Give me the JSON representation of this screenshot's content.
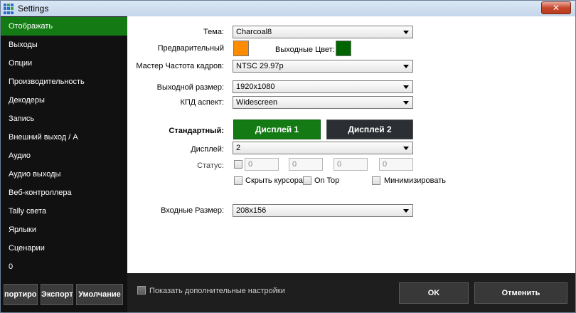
{
  "window": {
    "title": "Settings",
    "close_glyph": "✕",
    "icon": "app-grid-icon"
  },
  "sidebar": {
    "items": [
      {
        "label": "Отображать",
        "active": true
      },
      {
        "label": "Выходы"
      },
      {
        "label": "Опции"
      },
      {
        "label": "Производительность"
      },
      {
        "label": "Декодеры"
      },
      {
        "label": "Запись"
      },
      {
        "label": "Внешний выход / A"
      },
      {
        "label": "Аудио"
      },
      {
        "label": "Аудио выходы"
      },
      {
        "label": "Веб-контроллера"
      },
      {
        "label": "Tally света"
      },
      {
        "label": "Ярлыки"
      },
      {
        "label": "Сценарии"
      },
      {
        "label": "0"
      }
    ],
    "buttons": {
      "import": "портиров",
      "export": "Экспорт",
      "default": "Умолчание"
    }
  },
  "settings": {
    "theme": {
      "label": "Тема:",
      "value": "Charcoal8"
    },
    "preview": {
      "label": "Предварительный",
      "color": "#ff8c00"
    },
    "output_color": {
      "label": "Выходные Цвет:",
      "color": "#006400"
    },
    "master_framerate": {
      "label": "Мастер Частота кадров:",
      "value": "NTSC 29.97p"
    },
    "output_size": {
      "label": "Выходной размер:",
      "value": "1920x1080"
    },
    "aspect": {
      "label": "КПД аспект:",
      "value": "Widescreen"
    },
    "standard": {
      "label": "Стандартный:",
      "display1": "Дисплей 1",
      "display2": "Дисплей 2"
    },
    "display": {
      "label": "Дисплей:",
      "value": "2"
    },
    "status": {
      "label": "Статус:",
      "fields": [
        "0",
        "0",
        "0",
        "0"
      ]
    },
    "hide_cursor": {
      "label": "Скрыть курсора"
    },
    "on_top": {
      "label": "On Top"
    },
    "minimize": {
      "label": "Минимизировать"
    },
    "input_size": {
      "label": "Входные Размер:",
      "value": "208x156"
    }
  },
  "footer": {
    "show_advanced": "Показать дополнительные настройки",
    "ok": "OK",
    "cancel": "Отменить"
  },
  "colors": {
    "accent_green": "#137a14",
    "sidebar_bg": "#111111",
    "display2_bg": "#2b2f33"
  }
}
